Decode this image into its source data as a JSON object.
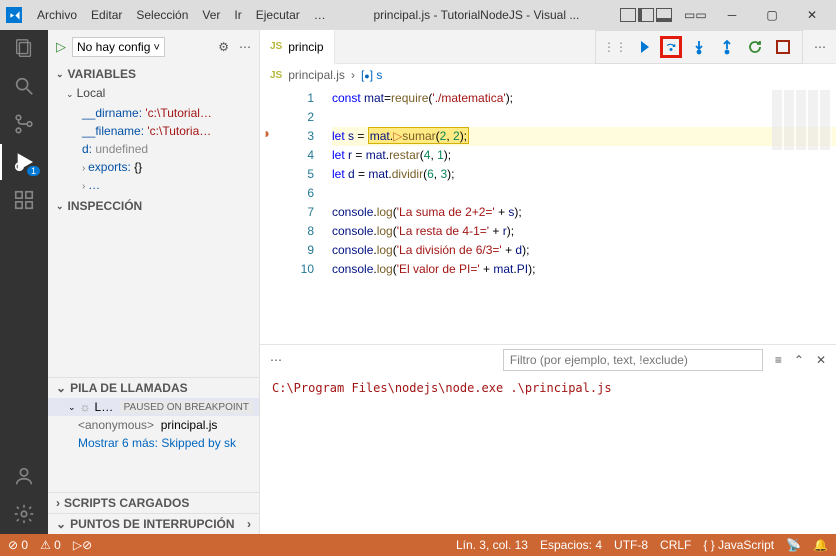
{
  "menu": {
    "file": "Archivo",
    "edit": "Editar",
    "selection": "Selección",
    "view": "Ver",
    "go": "Ir",
    "run": "Ejecutar",
    "more": "…"
  },
  "title": "principal.js - TutorialNodeJS - Visual ...",
  "sidebar": {
    "run_label": "No hay config",
    "sections": {
      "variables": "VARIABLES",
      "local": "Local",
      "inspection": "INSPECCIÓN",
      "callstack": "PILA DE LLAMADAS",
      "loaded": "SCRIPTS CARGADOS",
      "breakpoints": "PUNTOS DE INTERRUPCIÓN"
    },
    "vars": {
      "dirname_k": "__dirname:",
      "dirname_v": " 'c:\\Tutorial…",
      "filename_k": "__filename:",
      "filename_v": " 'c:\\Tutoria…",
      "d_k": "d:",
      "d_v": " undefined",
      "exports_k": "exports:",
      "exports_v": " {}",
      "more_k": "…"
    },
    "callstack": {
      "thread": "L…",
      "paused": "PAUSED ON BREAKPOINT",
      "frame_fn": "<anonymous>",
      "frame_file": "principal.js",
      "skip": "Mostrar 6 más: Skipped by sk"
    }
  },
  "tabs": {
    "principal": "princip"
  },
  "breadcrumb": {
    "file": "principal.js",
    "sym": "s"
  },
  "code": {
    "l1a": "const ",
    "l1b": "mat",
    "l1c": "=",
    "l1d": "require",
    "l1e": "(",
    "l1f": "'./matematica'",
    "l1g": ");",
    "l3a": "let ",
    "l3b": "s",
    "l3c": " = ",
    "l3d": "mat",
    "l3e": ".",
    "l3f": "sumar",
    "l3g": "(",
    "l3h": "2",
    "l3i": ", ",
    "l3j": "2",
    "l3k": ");",
    "l4a": "let ",
    "l4b": "r",
    "l4c": " = ",
    "l4d": "mat",
    "l4e": ".",
    "l4f": "restar",
    "l4g": "(",
    "l4h": "4",
    "l4i": ", ",
    "l4j": "1",
    "l4k": ");",
    "l5a": "let ",
    "l5b": "d",
    "l5c": " = ",
    "l5d": "mat",
    "l5e": ".",
    "l5f": "dividir",
    "l5g": "(",
    "l5h": "6",
    "l5i": ", ",
    "l5j": "3",
    "l5k": ");",
    "l7a": "console",
    "l7b": ".",
    "l7c": "log",
    "l7d": "(",
    "l7e": "'La suma de 2+2='",
    "l7f": " + ",
    "l7g": "s",
    "l7h": ");",
    "l8a": "console",
    "l8b": ".",
    "l8c": "log",
    "l8d": "(",
    "l8e": "'La resta de 4-1='",
    "l8f": " + ",
    "l8g": "r",
    "l8h": ");",
    "l9a": "console",
    "l9b": ".",
    "l9c": "log",
    "l9d": "(",
    "l9e": "'La división de 6/3='",
    "l9f": " + ",
    "l9g": "d",
    "l9h": ");",
    "l10a": "console",
    "l10b": ".",
    "l10c": "log",
    "l10d": "(",
    "l10e": "'El valor de PI='",
    "l10f": " + ",
    "l10g": "mat",
    "l10h": ".",
    "l10i": "PI",
    "l10j": ");"
  },
  "panel": {
    "filter_ph": "Filtro (por ejemplo, text, !exclude)",
    "output": "C:\\Program Files\\nodejs\\node.exe .\\principal.js"
  },
  "status": {
    "errors": "0",
    "warnings": "0",
    "cursor": "Lín. 3, col. 13",
    "spaces": "Espacios: 4",
    "enc": "UTF-8",
    "eol": "CRLF",
    "lang": "JavaScript"
  }
}
